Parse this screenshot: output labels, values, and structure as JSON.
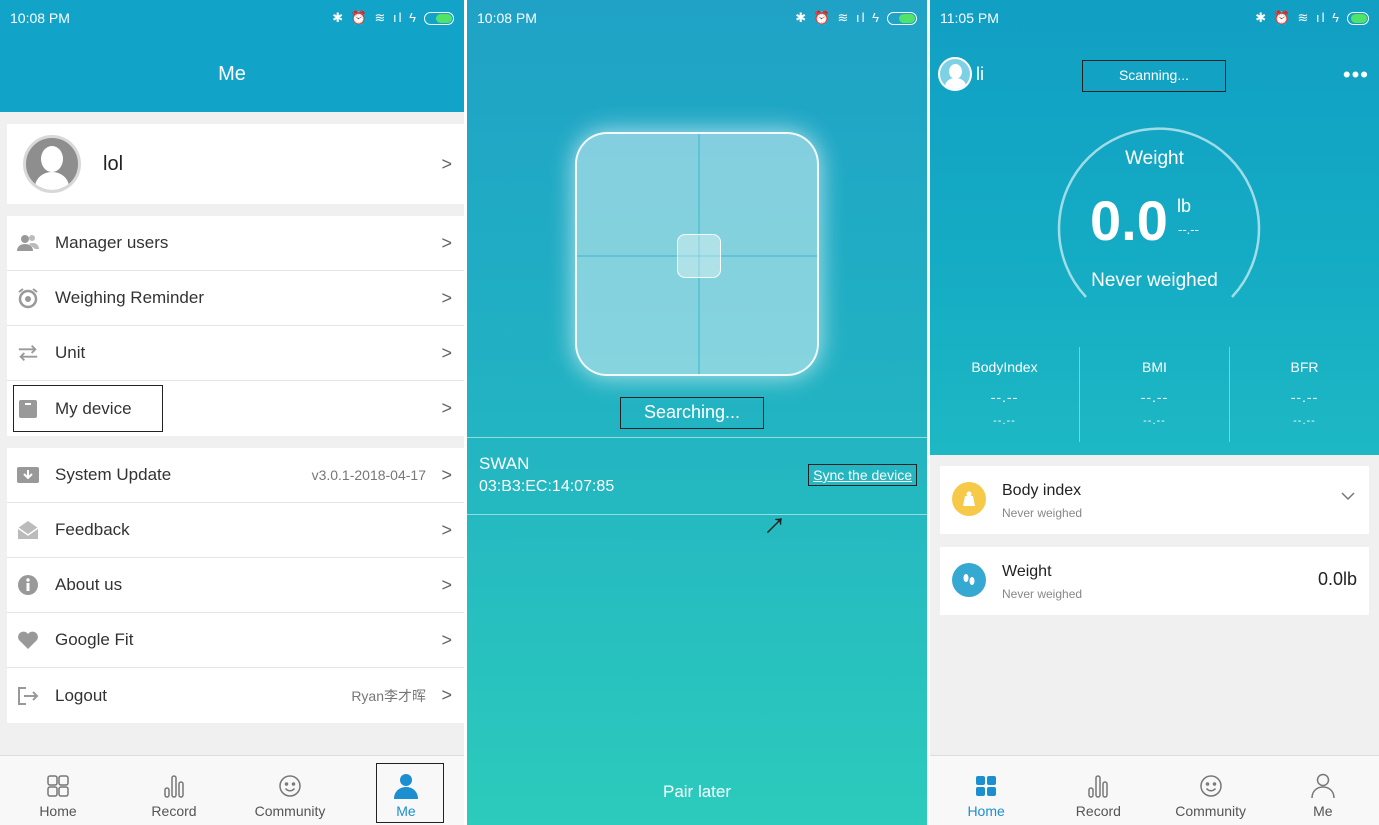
{
  "colors": {
    "header": "#12a3c9",
    "accent": "#1b8fd0",
    "battery": "#4fe36a"
  },
  "panel1": {
    "status": {
      "time": "10:08 PM",
      "icons": "✱ ⏰ ≋ ıl ϟ"
    },
    "header": {
      "title": "Me"
    },
    "profile": {
      "name": "lol",
      "chevron": ">"
    },
    "menu_group1": [
      {
        "icon": "users-icon",
        "label": "Manager users",
        "value": "",
        "chevron": ">"
      },
      {
        "icon": "alarm-icon",
        "label": "Weighing Reminder",
        "value": "",
        "chevron": ">"
      },
      {
        "icon": "swap-icon",
        "label": "Unit",
        "value": "",
        "chevron": ">"
      },
      {
        "icon": "device-icon",
        "label": "My device",
        "value": "",
        "chevron": ">"
      }
    ],
    "menu_group2": [
      {
        "icon": "download-icon",
        "label": "System Update",
        "value": "v3.0.1-2018-04-17",
        "chevron": ">"
      },
      {
        "icon": "mail-icon",
        "label": "Feedback",
        "value": "",
        "chevron": ">"
      },
      {
        "icon": "info-icon",
        "label": "About us",
        "value": "",
        "chevron": ">"
      },
      {
        "icon": "heart-icon",
        "label": "Google Fit",
        "value": "",
        "chevron": ">"
      },
      {
        "icon": "logout-icon",
        "label": "Logout",
        "value": "Ryan李才晖",
        "chevron": ">"
      }
    ],
    "tabs": [
      {
        "label": "Home",
        "icon": "home-grid-icon"
      },
      {
        "label": "Record",
        "icon": "bar-chart-icon"
      },
      {
        "label": "Community",
        "icon": "smile-icon"
      },
      {
        "label": "Me",
        "icon": "person-icon"
      }
    ]
  },
  "panel2": {
    "status": {
      "time": "10:08 PM",
      "icons": "✱ ⏰ ≋ ıl ϟ"
    },
    "searching": "Searching...",
    "device": {
      "name": "SWAN",
      "mac": "03:B3:EC:14:07:85",
      "sync_label": "Sync the device"
    },
    "pair_later": "Pair later"
  },
  "panel3": {
    "status": {
      "time": "11:05 PM",
      "icons": "✱ ⏰ ≋ ıl ϟ"
    },
    "user": {
      "name": "li"
    },
    "scanning": "Scanning...",
    "more": "•••",
    "weight": {
      "label": "Weight",
      "value": "0.0",
      "unit": "lb",
      "unit_sub": "--.--",
      "status": "Never weighed"
    },
    "stats": [
      {
        "label": "BodyIndex",
        "value": "--.--",
        "sub": "--.--"
      },
      {
        "label": "BMI",
        "value": "--.--",
        "sub": "--.--"
      },
      {
        "label": "BFR",
        "value": "--.--",
        "sub": "--.--"
      }
    ],
    "cards": [
      {
        "title": "Body index",
        "subtitle": "Never weighed",
        "value": "",
        "icon": "body-index-icon"
      },
      {
        "title": "Weight",
        "subtitle": "Never weighed",
        "value": "0.0lb",
        "icon": "footprints-icon"
      }
    ],
    "tabs": [
      {
        "label": "Home",
        "icon": "home-grid-icon"
      },
      {
        "label": "Record",
        "icon": "bar-chart-icon"
      },
      {
        "label": "Community",
        "icon": "smile-icon"
      },
      {
        "label": "Me",
        "icon": "person-icon"
      }
    ]
  }
}
